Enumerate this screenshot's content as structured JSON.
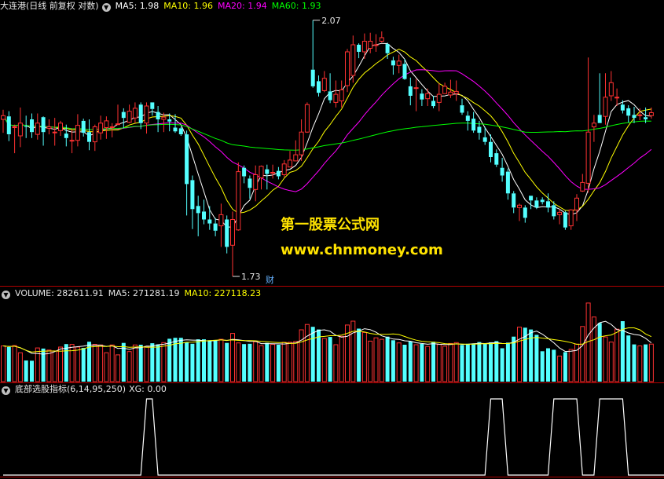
{
  "headers": {
    "price": {
      "title": "大连港(日线 前复权 对数)",
      "ma5": "MA5: 1.98",
      "ma10": "MA10: 1.96",
      "ma20": "MA20: 1.94",
      "ma60": "MA60: 1.93"
    },
    "volume": {
      "title": "VOLUME: 282611.91",
      "ma5": "MA5: 271281.19",
      "ma10": "MA10: 227118.23"
    },
    "indicator": {
      "title": "底部选股指标(6,14,95,250)",
      "xg": "XG: 0.00"
    }
  },
  "annotations": {
    "high": "2.07",
    "low": "1.73",
    "cai": "财"
  },
  "watermark": {
    "line1": "第一股票公式网",
    "line2": "www.chnmoney.com"
  },
  "colors": {
    "up": "#ff3232",
    "down": "#54ffff",
    "ma5": "#ffffff",
    "ma10": "#ffff00",
    "ma20": "#ff00ff",
    "ma60": "#00ff00",
    "panel_border": "#b00000",
    "watermark": "#ffe300"
  },
  "chart_data": [
    {
      "type": "candlestick",
      "panel": "price",
      "ylim": [
        1.73,
        2.07
      ],
      "candles": [
        [
          1.93,
          1.935,
          1.943,
          1.912
        ],
        [
          1.934,
          1.91,
          1.941,
          1.901
        ],
        [
          1.92,
          1.92,
          1.923,
          1.885
        ],
        [
          1.908,
          1.925,
          1.946,
          1.893
        ],
        [
          1.921,
          1.92,
          1.935,
          1.905
        ],
        [
          1.93,
          1.913,
          1.938,
          1.905
        ],
        [
          1.91,
          1.925,
          1.938,
          1.903
        ],
        [
          1.933,
          1.913,
          1.934,
          1.895
        ],
        [
          1.918,
          1.92,
          1.93,
          1.91
        ],
        [
          1.912,
          1.913,
          1.932,
          1.895
        ],
        [
          1.915,
          1.925,
          1.928,
          1.908
        ],
        [
          1.911,
          1.905,
          1.923,
          1.894
        ],
        [
          1.901,
          1.902,
          1.918,
          1.885
        ],
        [
          1.902,
          1.922,
          1.937,
          1.894
        ],
        [
          1.928,
          1.912,
          1.931,
          1.907
        ],
        [
          1.913,
          1.9,
          1.93,
          1.889
        ],
        [
          1.9,
          1.92,
          1.923,
          1.888
        ],
        [
          1.912,
          1.925,
          1.935,
          1.903
        ],
        [
          1.919,
          1.928,
          1.934,
          1.904
        ],
        [
          1.92,
          1.92,
          1.925,
          1.906
        ],
        [
          1.924,
          1.924,
          1.95,
          1.923
        ],
        [
          1.94,
          1.932,
          1.945,
          1.918
        ],
        [
          1.926,
          1.941,
          1.95,
          1.925
        ],
        [
          1.932,
          1.945,
          1.953,
          1.925
        ],
        [
          1.95,
          1.925,
          1.953,
          1.917
        ],
        [
          1.925,
          1.948,
          1.953,
          1.911
        ],
        [
          1.953,
          1.944,
          1.953,
          1.935
        ],
        [
          1.94,
          1.93,
          1.948,
          1.913
        ],
        [
          1.93,
          1.933,
          1.939,
          1.913
        ],
        [
          1.93,
          1.927,
          1.938,
          1.914
        ],
        [
          1.919,
          1.914,
          1.937,
          1.912
        ],
        [
          1.918,
          1.91,
          1.92,
          1.908
        ],
        [
          1.91,
          1.845,
          1.915,
          1.805
        ],
        [
          1.85,
          1.813,
          1.856,
          1.788
        ],
        [
          1.817,
          1.808,
          1.83,
          1.779
        ],
        [
          1.81,
          1.8,
          1.825,
          1.794
        ],
        [
          1.8,
          1.795,
          1.817,
          1.787
        ],
        [
          1.795,
          1.786,
          1.802,
          1.779
        ],
        [
          1.792,
          1.806,
          1.82,
          1.766
        ],
        [
          1.8,
          1.766,
          1.805,
          1.758
        ],
        [
          1.768,
          1.8,
          1.81,
          1.73
        ],
        [
          1.787,
          1.861,
          1.873,
          1.786
        ],
        [
          1.866,
          1.855,
          1.869,
          1.846
        ],
        [
          1.852,
          1.84,
          1.856,
          1.826
        ],
        [
          1.838,
          1.857,
          1.869,
          1.823
        ],
        [
          1.853,
          1.868,
          1.869,
          1.838
        ],
        [
          1.864,
          1.858,
          1.87,
          1.838
        ],
        [
          1.86,
          1.86,
          1.87,
          1.852
        ],
        [
          1.862,
          1.855,
          1.867,
          1.851
        ],
        [
          1.857,
          1.871,
          1.876,
          1.854
        ],
        [
          1.867,
          1.876,
          1.888,
          1.867
        ],
        [
          1.875,
          1.883,
          1.902,
          1.875
        ],
        [
          1.883,
          1.913,
          1.93,
          1.875
        ],
        [
          1.913,
          1.95,
          1.953,
          1.912
        ],
        [
          1.998,
          1.975,
          2.068,
          1.973
        ],
        [
          1.982,
          1.966,
          1.99,
          1.961
        ],
        [
          1.969,
          1.986,
          1.996,
          1.967
        ],
        [
          1.968,
          1.956,
          1.993,
          1.952
        ],
        [
          1.953,
          1.964,
          1.983,
          1.946
        ],
        [
          1.955,
          1.97,
          1.983,
          1.946
        ],
        [
          1.976,
          2.023,
          2.027,
          1.967
        ],
        [
          1.99,
          2.033,
          2.046,
          1.98
        ],
        [
          2.033,
          2.023,
          2.035,
          2.014
        ],
        [
          2.023,
          2.038,
          2.049,
          2.013
        ],
        [
          2.028,
          2.038,
          2.05,
          2.021
        ],
        [
          2.033,
          2.033,
          2.048,
          2.023
        ],
        [
          2.038,
          2.043,
          2.052,
          2.036
        ],
        [
          2.034,
          2.021,
          2.036,
          2.013
        ],
        [
          2.011,
          2.004,
          2.016,
          1.991
        ],
        [
          2.004,
          2.01,
          2.019,
          1.993
        ],
        [
          2.006,
          1.985,
          2.013,
          1.984
        ],
        [
          1.975,
          1.962,
          1.987,
          1.949
        ],
        [
          1.973,
          1.973,
          1.985,
          1.941
        ],
        [
          1.965,
          1.957,
          1.971,
          1.948
        ],
        [
          1.958,
          1.965,
          1.972,
          1.948
        ],
        [
          1.955,
          1.948,
          1.962,
          1.945
        ],
        [
          1.953,
          1.964,
          1.979,
          1.941
        ],
        [
          1.965,
          1.975,
          1.98,
          1.965
        ],
        [
          1.963,
          1.967,
          1.984,
          1.959
        ],
        [
          1.965,
          1.968,
          1.983,
          1.955
        ],
        [
          1.949,
          1.939,
          1.958,
          1.936
        ],
        [
          1.935,
          1.928,
          1.941,
          1.915
        ],
        [
          1.931,
          1.915,
          1.94,
          1.912
        ],
        [
          1.92,
          1.912,
          1.928,
          1.903
        ],
        [
          1.906,
          1.9,
          1.92,
          1.896
        ],
        [
          1.9,
          1.88,
          1.91,
          1.873
        ],
        [
          1.885,
          1.87,
          1.89,
          1.867
        ],
        [
          1.866,
          1.856,
          1.879,
          1.848
        ],
        [
          1.861,
          1.833,
          1.865,
          1.825
        ],
        [
          1.833,
          1.815,
          1.836,
          1.808
        ],
        [
          1.815,
          1.818,
          1.82,
          1.798
        ],
        [
          1.815,
          1.802,
          1.818,
          1.796
        ],
        [
          1.83,
          1.824,
          1.83,
          1.813
        ],
        [
          1.824,
          1.815,
          1.828,
          1.813
        ],
        [
          1.825,
          1.822,
          1.828,
          1.819
        ],
        [
          1.823,
          1.815,
          1.833,
          1.809
        ],
        [
          1.818,
          1.804,
          1.823,
          1.8
        ],
        [
          1.806,
          1.809,
          1.813,
          1.794
        ],
        [
          1.809,
          1.79,
          1.811,
          1.787
        ],
        [
          1.792,
          1.812,
          1.813,
          1.787
        ],
        [
          1.812,
          1.827,
          1.832,
          1.798
        ],
        [
          1.836,
          1.847,
          1.858,
          1.835
        ],
        [
          1.846,
          1.913,
          2.015,
          1.834
        ],
        [
          1.92,
          1.925,
          1.936,
          1.9
        ],
        [
          1.936,
          1.925,
          1.993,
          1.925
        ],
        [
          1.934,
          1.96,
          1.993,
          1.923
        ],
        [
          1.962,
          1.98,
          1.996,
          1.955
        ],
        [
          1.96,
          1.96,
          1.972,
          1.948
        ],
        [
          1.95,
          1.942,
          1.956,
          1.938
        ],
        [
          1.945,
          1.935,
          1.949,
          1.926
        ],
        [
          1.936,
          1.932,
          1.947,
          1.925
        ],
        [
          1.935,
          1.936,
          1.945,
          1.929
        ],
        [
          1.933,
          1.93,
          1.946,
          1.925
        ],
        [
          1.935,
          1.939,
          1.946,
          1.931
        ]
      ],
      "ma_periods": [
        5,
        10,
        20,
        60
      ]
    },
    {
      "type": "bar",
      "panel": "volume",
      "values": [
        120000,
        116000,
        121000,
        97000,
        71000,
        70000,
        113000,
        111000,
        106000,
        103000,
        116000,
        126000,
        125000,
        116000,
        113000,
        134000,
        125000,
        123000,
        97000,
        123000,
        90000,
        130000,
        101000,
        123000,
        124000,
        118000,
        129000,
        125000,
        131000,
        144000,
        147000,
        147000,
        132000,
        127000,
        142000,
        142000,
        139000,
        138000,
        142000,
        130000,
        162000,
        130000,
        126000,
        127000,
        134000,
        121000,
        130000,
        125000,
        124000,
        132000,
        132000,
        135000,
        174000,
        192000,
        184000,
        175000,
        145000,
        150000,
        124000,
        152000,
        190000,
        203000,
        178000,
        165000,
        136000,
        147000,
        142000,
        151000,
        139000,
        130000,
        124000,
        135000,
        124000,
        127000,
        118000,
        134000,
        125000,
        119000,
        128000,
        131000,
        123000,
        127000,
        128000,
        133000,
        128000,
        132000,
        136000,
        112000,
        131000,
        151000,
        183000,
        181000,
        175000,
        157000,
        102000,
        112000,
        107000,
        86000,
        99000,
        108000,
        126000,
        185000,
        264000,
        217000,
        197000,
        150000,
        133000,
        176000,
        203000,
        155000,
        125000,
        120000,
        125000,
        126000
      ],
      "ma_periods": [
        5,
        10
      ]
    },
    {
      "type": "line",
      "panel": "indicator",
      "name": "XG",
      "segments": [
        {
          "from": 25,
          "to": 26
        },
        {
          "from": 85,
          "to": 87
        },
        {
          "from": 96,
          "to": 100
        },
        {
          "from": 104,
          "to": 108
        }
      ]
    }
  ]
}
